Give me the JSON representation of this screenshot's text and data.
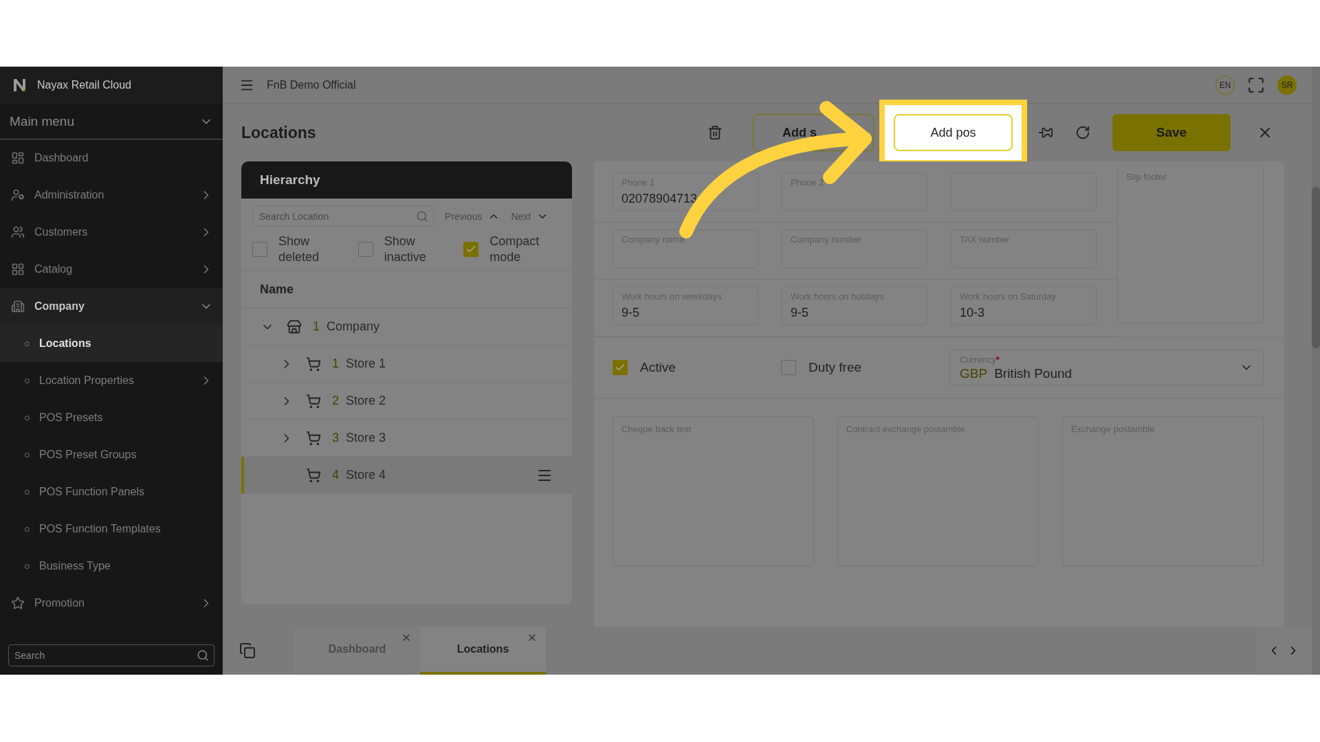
{
  "app": {
    "brand": "Nayax Retail Cloud",
    "workspace": "FnB Demo Official",
    "language": "EN",
    "user_initials": "SR"
  },
  "sidebar": {
    "section": "Main menu",
    "items": [
      {
        "label": "Dashboard",
        "kind": "top",
        "expandable": false,
        "selected": false
      },
      {
        "label": "Administration",
        "kind": "top",
        "expandable": true,
        "expanded": false,
        "selected": false
      },
      {
        "label": "Customers",
        "kind": "top",
        "expandable": true,
        "expanded": false,
        "selected": false
      },
      {
        "label": "Catalog",
        "kind": "top",
        "expandable": true,
        "expanded": false,
        "selected": false
      },
      {
        "label": "Company",
        "kind": "top",
        "expandable": true,
        "expanded": true,
        "selected": false
      },
      {
        "label": "Locations",
        "kind": "sub",
        "expandable": false,
        "selected": true
      },
      {
        "label": "Location Properties",
        "kind": "sub",
        "expandable": true,
        "expanded": false,
        "selected": false
      },
      {
        "label": "POS Presets",
        "kind": "sub",
        "expandable": false,
        "selected": false
      },
      {
        "label": "POS Preset Groups",
        "kind": "sub",
        "expandable": false,
        "selected": false
      },
      {
        "label": "POS Function Panels",
        "kind": "sub",
        "expandable": false,
        "selected": false
      },
      {
        "label": "POS Function Templates",
        "kind": "sub",
        "expandable": false,
        "selected": false
      },
      {
        "label": "Business Type",
        "kind": "sub",
        "expandable": false,
        "selected": false
      },
      {
        "label": "Promotion",
        "kind": "top",
        "expandable": true,
        "expanded": false,
        "selected": false
      }
    ],
    "search": {
      "placeholder": "Search"
    }
  },
  "page": {
    "title": "Locations",
    "add_store": "Add s",
    "add_pos": {
      "label": "Add pos",
      "highlighted": true
    },
    "save": "Save"
  },
  "hierarchy": {
    "title": "Hierarchy",
    "search": {
      "placeholder": "Search Location"
    },
    "previous": "Previous",
    "next": "Next",
    "options": [
      {
        "label": "Show deleted",
        "checked": false
      },
      {
        "label": "Show inactive",
        "checked": false
      },
      {
        "label": "Compact mode",
        "checked": true
      }
    ],
    "column": "Name",
    "tree": [
      {
        "number": "1",
        "name": "Company",
        "kind": "company",
        "expandable": true,
        "expanded": true,
        "selected": false,
        "children": [
          {
            "number": "1",
            "name": "Store 1",
            "kind": "store",
            "expandable": true,
            "selected": false
          },
          {
            "number": "2",
            "name": "Store 2",
            "kind": "store",
            "expandable": true,
            "selected": false
          },
          {
            "number": "3",
            "name": "Store 3",
            "kind": "store",
            "expandable": true,
            "selected": false
          },
          {
            "number": "4",
            "name": "Store 4",
            "kind": "store",
            "expandable": false,
            "selected": true
          }
        ]
      }
    ]
  },
  "form": {
    "field_rows": [
      [
        {
          "label": "Phone 1",
          "value": "02078904713"
        },
        {
          "label": "Phone 2"
        },
        {}
      ],
      [
        {
          "label": "Company name"
        },
        {
          "label": "Company number"
        },
        {
          "label": "TAX number"
        }
      ],
      [
        {
          "label": "Work hours on weekdays",
          "value": "9-5"
        },
        {
          "label": "Work hours on holidays",
          "value": "9-5"
        },
        {
          "label": "Work hours on Saturday",
          "value": "10-3"
        }
      ]
    ],
    "slip_footer": {
      "label": "Slip footer"
    },
    "options": [
      {
        "label": "Active",
        "checked": true
      },
      {
        "label": "Duty free",
        "checked": false
      }
    ],
    "currency": {
      "label": "Currency",
      "required_mark": "*",
      "code": "GBP",
      "value": "British Pound"
    },
    "text_areas": [
      {
        "label": "Cheque back text"
      },
      {
        "label": "Contract exchange postamble"
      },
      {
        "label": "Exchange postamble"
      }
    ]
  },
  "tabs": [
    {
      "label": "Dashboard",
      "selected": false
    },
    {
      "label": "Locations",
      "selected": true
    }
  ]
}
